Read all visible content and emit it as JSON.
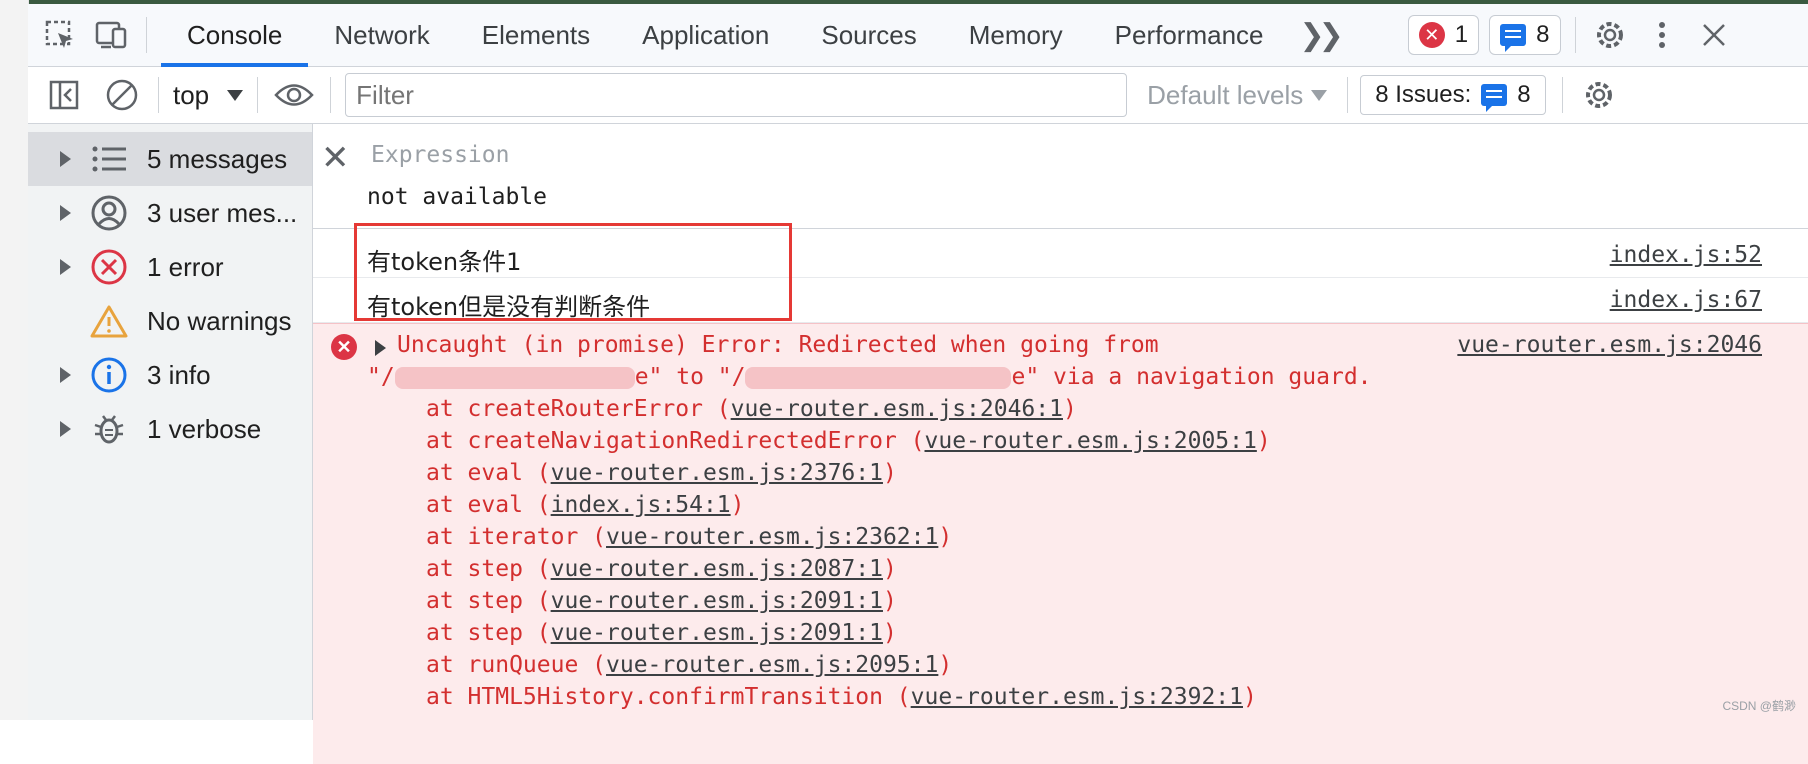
{
  "tabs": [
    "Console",
    "Network",
    "Elements",
    "Application",
    "Sources",
    "Memory",
    "Performance"
  ],
  "tabbar": {
    "more": "»",
    "error_count": "1",
    "message_count": "8"
  },
  "filterbar": {
    "context": "top",
    "filter_placeholder": "Filter",
    "levels": "Default levels",
    "issues_label": "8 Issues:",
    "issues_count": "8"
  },
  "sidebar": {
    "items": [
      {
        "label": "5 messages",
        "icon": "list-icon"
      },
      {
        "label": "3 user mes...",
        "icon": "user-icon"
      },
      {
        "label": "1 error",
        "icon": "error-icon"
      },
      {
        "label": "No warnings",
        "icon": "warning-icon"
      },
      {
        "label": "3 info",
        "icon": "info-icon"
      },
      {
        "label": "1 verbose",
        "icon": "bug-icon"
      }
    ]
  },
  "expression": {
    "label": "Expression",
    "value": "not available"
  },
  "logs": [
    {
      "text": "有token条件1",
      "source": "index.js:52"
    },
    {
      "text": "有token但是没有判断条件",
      "source": "index.js:67"
    }
  ],
  "error": {
    "message_line1": "Uncaught (in promise) Error: Redirected when going from",
    "source": "vue-router.esm.js:2046",
    "line2_a": "\"/",
    "line2_b": "e\" to \"/",
    "line2_c": "e\" via a navigation guard.",
    "stack": [
      {
        "fn": "at createRouterError (",
        "link": "vue-router.esm.js:2046:1",
        "end": ")"
      },
      {
        "fn": "at createNavigationRedirectedError (",
        "link": "vue-router.esm.js:2005:1",
        "end": ")"
      },
      {
        "fn": "at eval (",
        "link": "vue-router.esm.js:2376:1",
        "end": ")"
      },
      {
        "fn": "at eval (",
        "link": "index.js:54:1",
        "end": ")"
      },
      {
        "fn": "at iterator (",
        "link": "vue-router.esm.js:2362:1",
        "end": ")"
      },
      {
        "fn": "at step (",
        "link": "vue-router.esm.js:2087:1",
        "end": ")"
      },
      {
        "fn": "at step (",
        "link": "vue-router.esm.js:2091:1",
        "end": ")"
      },
      {
        "fn": "at step (",
        "link": "vue-router.esm.js:2091:1",
        "end": ")"
      },
      {
        "fn": "at runQueue (",
        "link": "vue-router.esm.js:2095:1",
        "end": ")"
      },
      {
        "fn": "at HTML5History.confirmTransition (",
        "link": "vue-router.esm.js:2392:1",
        "end": ")"
      }
    ]
  },
  "watermark": "CSDN @鹤渺",
  "colors": {
    "accent": "#1a73e8",
    "error": "#d32f2f",
    "error_bg": "#fdebec",
    "highlight_box": "#e53935"
  }
}
